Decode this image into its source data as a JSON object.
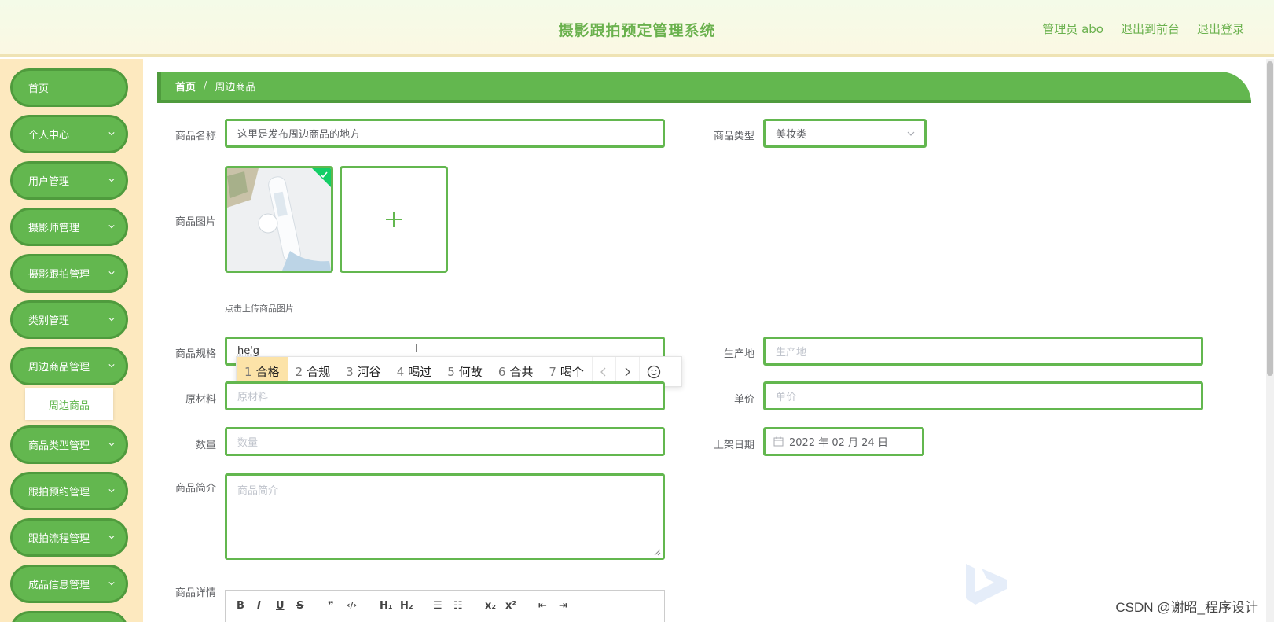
{
  "header": {
    "title": "摄影跟拍预定管理系统",
    "user": "管理员 abo",
    "to_front": "退出到前台",
    "logout": "退出登录"
  },
  "sidebar": {
    "items": [
      {
        "label": "首页"
      },
      {
        "label": "个人中心"
      },
      {
        "label": "用户管理"
      },
      {
        "label": "摄影师管理"
      },
      {
        "label": "摄影跟拍管理"
      },
      {
        "label": "类别管理"
      },
      {
        "label": "周边商品管理"
      },
      {
        "label": "商品类型管理"
      },
      {
        "label": "跟拍预约管理"
      },
      {
        "label": "跟拍流程管理"
      },
      {
        "label": "成品信息管理"
      }
    ],
    "submenu": {
      "label": "周边商品"
    }
  },
  "breadcrumb": {
    "home": "首页",
    "separator": "/",
    "current": "周边商品"
  },
  "form": {
    "name": {
      "label": "商品名称",
      "value": "这里是发布周边商品的地方"
    },
    "type": {
      "label": "商品类型",
      "value": "美妆类"
    },
    "image": {
      "label": "商品图片",
      "hint": "点击上传商品图片"
    },
    "spec": {
      "label": "商品规格",
      "value": "he'g"
    },
    "origin": {
      "label": "生产地",
      "placeholder": "生产地"
    },
    "material": {
      "label": "原材料",
      "placeholder": "原材料"
    },
    "price": {
      "label": "单价",
      "placeholder": "单价"
    },
    "quantity": {
      "label": "数量",
      "placeholder": "数量"
    },
    "date": {
      "label": "上架日期",
      "value": "2022 年 02 月 24 日"
    },
    "intro": {
      "label": "商品简介",
      "placeholder": "商品简介"
    },
    "detail": {
      "label": "商品详情"
    }
  },
  "ime": {
    "candidates": [
      {
        "num": "1",
        "text": "合格"
      },
      {
        "num": "2",
        "text": "合规"
      },
      {
        "num": "3",
        "text": "河谷"
      },
      {
        "num": "4",
        "text": "喝过"
      },
      {
        "num": "5",
        "text": "何故"
      },
      {
        "num": "6",
        "text": "合共"
      },
      {
        "num": "7",
        "text": "喝个"
      }
    ]
  },
  "editor": {
    "tools": [
      "B",
      "I",
      "U",
      "S",
      "❞",
      "‹/›",
      "H₁",
      "H₂",
      "☰",
      "☷",
      "x₂",
      "x²",
      "⇤",
      "⇥"
    ]
  },
  "watermark": "CSDN @谢昭_程序设计",
  "colors": {
    "accent": "#63b74f",
    "accent_dark": "#4f9b3d",
    "sidebar_bg": "#fde9bf",
    "header_text": "#6ab14d"
  }
}
